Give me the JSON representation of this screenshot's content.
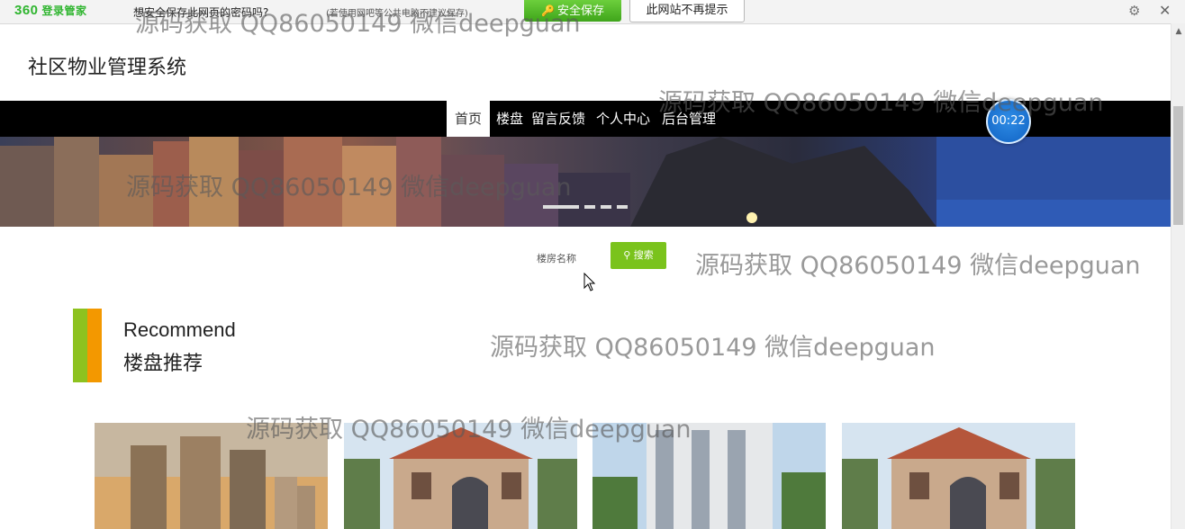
{
  "password_bar": {
    "logo": "360",
    "logo_sub": "登录管家",
    "question": "想安全保存此网页的密码吗?",
    "hint": "(若使用网吧等公共电脑不建议保存)",
    "save_button": "安全保存",
    "never_button": "此网站不再提示"
  },
  "site_title": "社区物业管理系统",
  "nav": {
    "items": [
      {
        "label": "首页",
        "active": true
      },
      {
        "label": "楼盘"
      },
      {
        "label": "留言反馈"
      },
      {
        "label": "个人中心"
      },
      {
        "label": "后台管理"
      }
    ]
  },
  "timer": "00:22",
  "search": {
    "label": "楼房名称",
    "button": "搜索"
  },
  "recommend": {
    "title_en": "Recommend",
    "title_cn": "楼盘推荐"
  },
  "watermark": "源码获取 QQ86050149 微信deepguan",
  "colors": {
    "nav_bg": "#000000",
    "accent_green": "#7ac31c",
    "accent_orange": "#f39800",
    "save_green": "#4cb525"
  }
}
